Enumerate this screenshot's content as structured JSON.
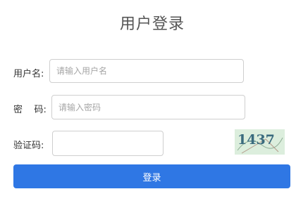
{
  "page": {
    "title": "用户登录"
  },
  "form": {
    "username": {
      "label": "用户名:",
      "placeholder": "请输入用户名",
      "value": ""
    },
    "password": {
      "label": "密    码:",
      "placeholder": "请输入密码",
      "value": ""
    },
    "captcha": {
      "label": "验证码:",
      "placeholder": "",
      "value": "",
      "image_text": "1437"
    },
    "submit_label": "登录"
  },
  "colors": {
    "primary": "#2f77e4",
    "captcha_bg": "#dceedd",
    "captcha_text": "#3a6b7e"
  }
}
